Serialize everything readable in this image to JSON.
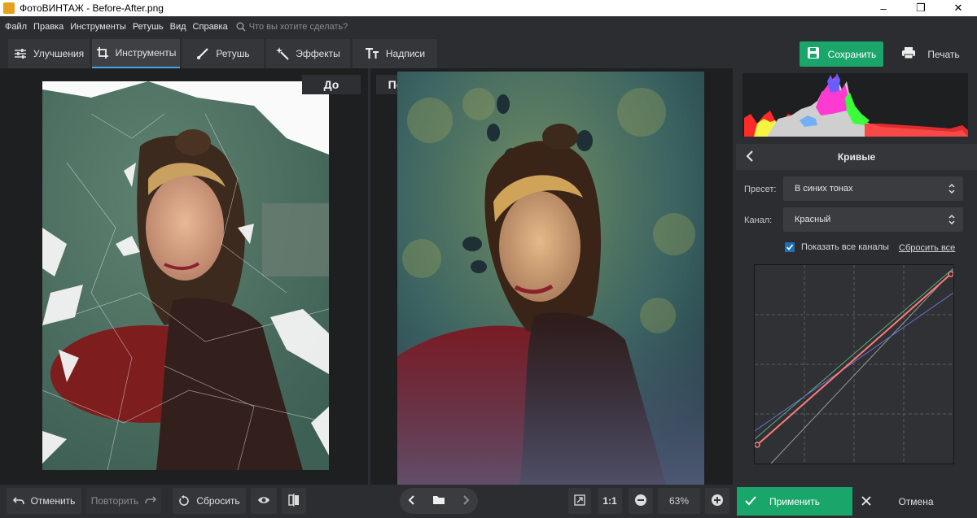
{
  "window": {
    "title": "ФотоВИНТАЖ - Before-After.png",
    "controls": [
      "minimize-icon",
      "maximize-icon",
      "close-icon"
    ]
  },
  "menu": {
    "items": [
      "Файл",
      "Правка",
      "Инструменты",
      "Ретушь",
      "Вид",
      "Справка"
    ],
    "search_placeholder": "Что вы хотите сделать?"
  },
  "tabs": [
    {
      "label": "Улучшения",
      "icon": "sliders-icon"
    },
    {
      "label": "Инструменты",
      "icon": "crop-icon",
      "active": true
    },
    {
      "label": "Ретушь",
      "icon": "brush-icon"
    },
    {
      "label": "Эффекты",
      "icon": "magic-wand-icon"
    },
    {
      "label": "Надписи",
      "icon": "text-icon"
    }
  ],
  "toolbar": {
    "save_label": "Сохранить",
    "print_label": "Печать"
  },
  "compare": {
    "before_label": "До",
    "after_label": "После"
  },
  "panel": {
    "title": "Кривые",
    "preset_label": "Пресет:",
    "preset_value": "В синих тонах",
    "channel_label": "Канал:",
    "channel_value": "Красный",
    "show_all_label": "Показать все каналы",
    "show_all_checked": true,
    "reset_all_label": "Сбросить все"
  },
  "bottom": {
    "undo_label": "Отменить",
    "redo_label": "Повторить",
    "reset_label": "Сбросить",
    "zoom_1to1": "1:1",
    "zoom_value": "63%",
    "apply_label": "Применить",
    "cancel_label": "Отмена"
  },
  "colors": {
    "accent_green": "#1aa56a",
    "active_tab_underline": "#4aa3df",
    "curve_red": "#ff7a7a",
    "curve_green": "#5fae7a",
    "curve_blue": "#6a6fd0"
  }
}
